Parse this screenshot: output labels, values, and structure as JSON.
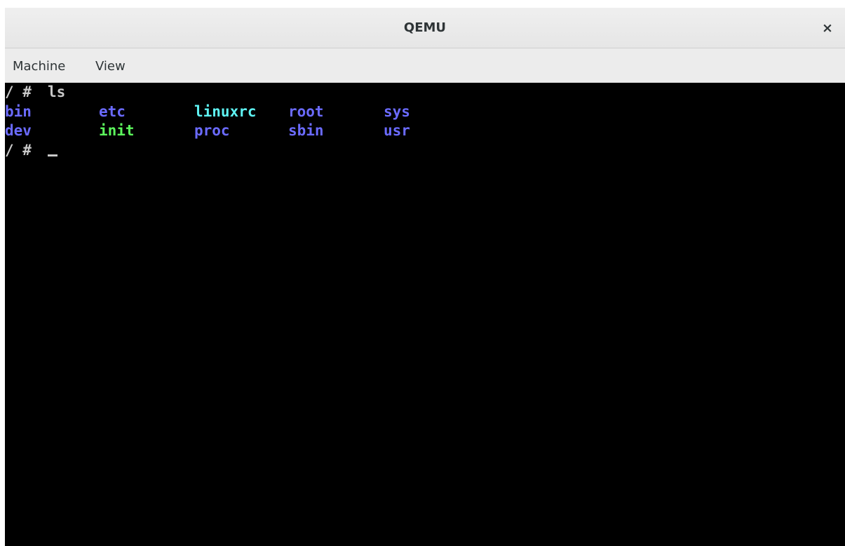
{
  "window": {
    "title": "QEMU",
    "close_glyph": "×"
  },
  "menubar": {
    "items": [
      "Machine",
      "View"
    ]
  },
  "terminal": {
    "colors": {
      "background": "#000000",
      "default": "#c8c8c8",
      "directory": "#6b6bff",
      "executable": "#5cf55c",
      "symlink": "#5ef2f2"
    },
    "command_line": {
      "prompt": "/ #",
      "command": "ls"
    },
    "listing": [
      [
        {
          "name": "bin",
          "type": "directory"
        },
        {
          "name": "etc",
          "type": "directory"
        },
        {
          "name": "linuxrc",
          "type": "symlink"
        },
        {
          "name": "root",
          "type": "directory"
        },
        {
          "name": "sys",
          "type": "directory"
        }
      ],
      [
        {
          "name": "dev",
          "type": "directory"
        },
        {
          "name": "init",
          "type": "executable"
        },
        {
          "name": "proc",
          "type": "directory"
        },
        {
          "name": "sbin",
          "type": "directory"
        },
        {
          "name": "usr",
          "type": "directory"
        }
      ]
    ],
    "prompt_line": {
      "prompt": "/ #",
      "cursor": "_"
    }
  }
}
